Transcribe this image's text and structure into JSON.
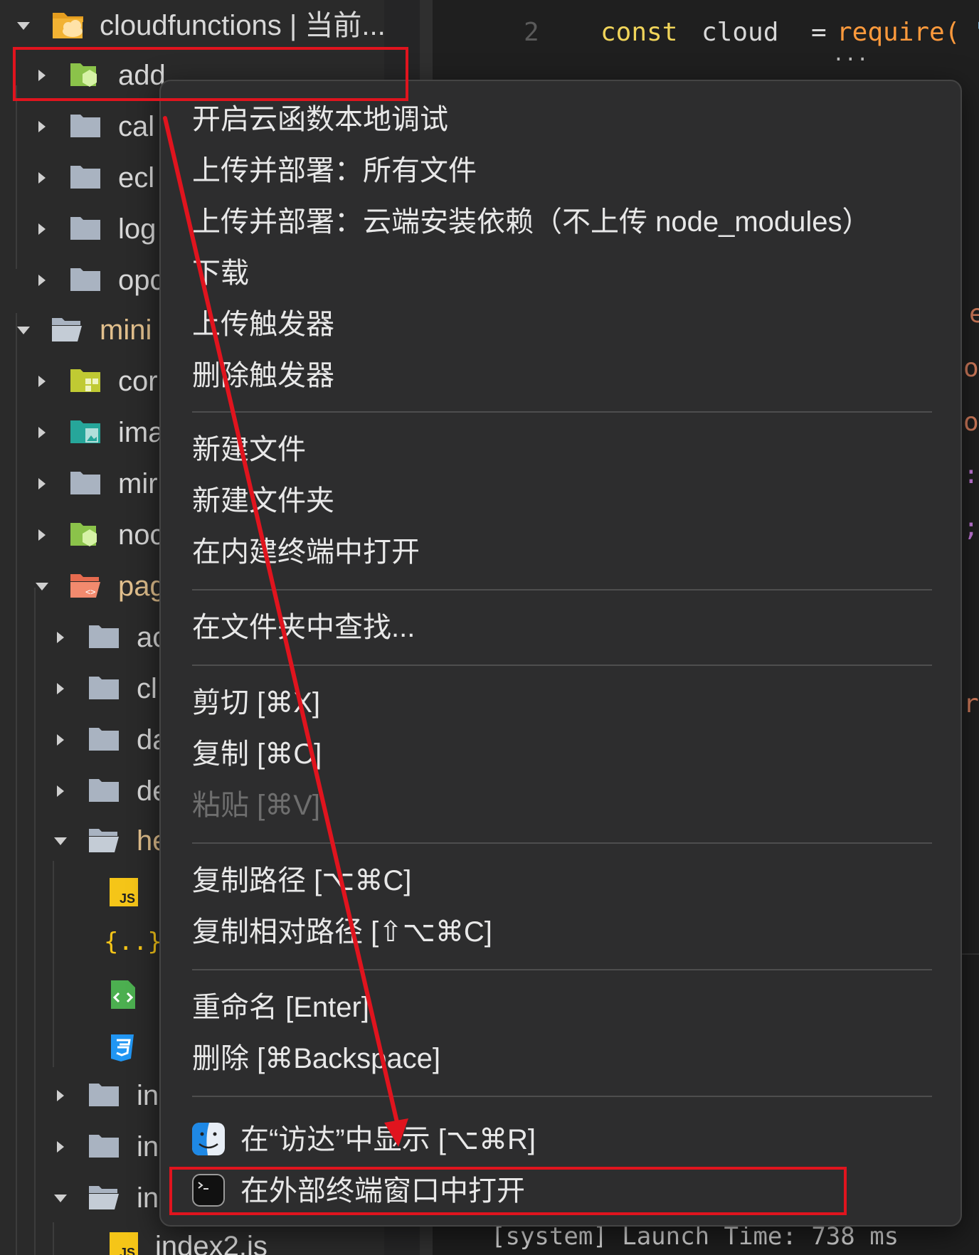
{
  "tree": {
    "root_label": "cloudfunctions | 当前...",
    "items": [
      {
        "label": "add"
      },
      {
        "label": "cal"
      },
      {
        "label": "ecl"
      },
      {
        "label": "log"
      },
      {
        "label": "opc"
      },
      {
        "label": "mini"
      },
      {
        "label": "cor"
      },
      {
        "label": "ima"
      },
      {
        "label": "mir"
      },
      {
        "label": "noc"
      },
      {
        "label": "pag"
      },
      {
        "label": "ac"
      },
      {
        "label": "cl"
      },
      {
        "label": "da"
      },
      {
        "label": "de"
      },
      {
        "label": "he"
      },
      {
        "label": "in"
      },
      {
        "label": "in"
      },
      {
        "label": "in"
      },
      {
        "label": "index2.js"
      }
    ],
    "file_icons": {
      "js": "JS",
      "json": "{..}"
    }
  },
  "editor": {
    "line_number": "2",
    "code_const": "const",
    "code_cloud": "cloud",
    "code_eq": "=",
    "code_require": "require(",
    "code_quote": "'",
    "ellipsis": "...",
    "status": "[system] Launch Time: 738 ms",
    "side_chars": [
      "e",
      "os",
      "ot",
      ":(",
      ";)",
      "rr"
    ]
  },
  "menu": {
    "items": [
      {
        "label": "开启云函数本地调试"
      },
      {
        "label": "上传并部署：所有文件"
      },
      {
        "label": "上传并部署：云端安装依赖（不上传 node_modules）"
      },
      {
        "label": "下载"
      },
      {
        "label": "上传触发器"
      },
      {
        "label": "删除触发器"
      },
      {
        "label": "新建文件"
      },
      {
        "label": "新建文件夹"
      },
      {
        "label": "在内建终端中打开"
      },
      {
        "label": "在文件夹中查找..."
      },
      {
        "label": "剪切 [⌘X]"
      },
      {
        "label": "复制 [⌘C]"
      },
      {
        "label": "粘贴 [⌘V]"
      },
      {
        "label": "复制路径 [⌥⌘C]"
      },
      {
        "label": "复制相对路径 [⇧⌥⌘C]"
      },
      {
        "label": "重命名 [Enter]"
      },
      {
        "label": "删除 [⌘Backspace]"
      },
      {
        "label": "在“访达”中显示 [⌥⌘R]"
      },
      {
        "label": "在外部终端窗口中打开"
      }
    ]
  },
  "colors": {
    "annotation": "#e0141e",
    "folder": "#a9b3c1",
    "cloud_folder": "#f2b233",
    "node_green": "#8bc34a"
  }
}
